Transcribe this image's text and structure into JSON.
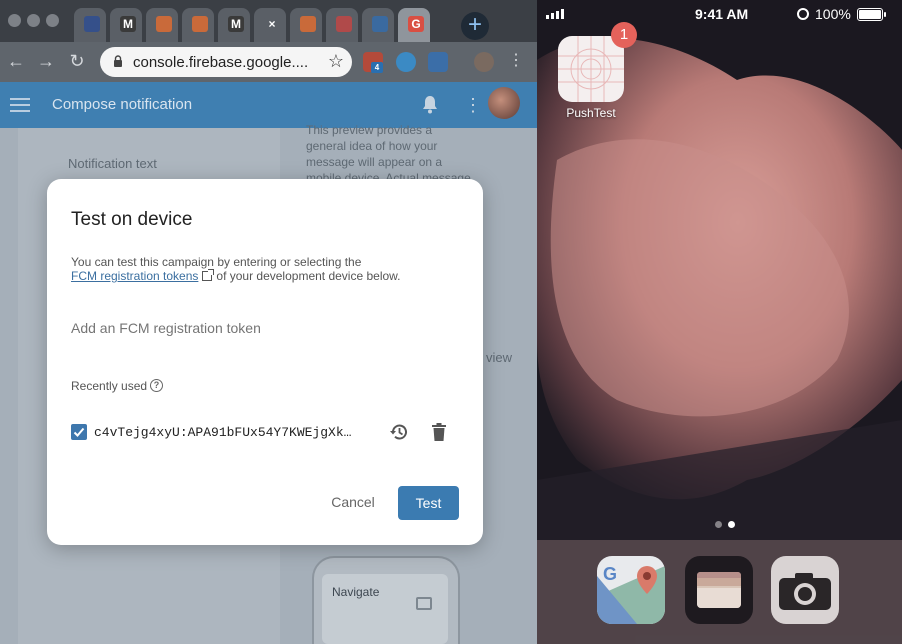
{
  "browser": {
    "url": "console.firebase.google....",
    "tabs": [
      {
        "fav": "",
        "color": "#35508a"
      },
      {
        "fav": "M",
        "color": "#3a3a3a"
      },
      {
        "fav": "",
        "color": "#c96a3a"
      },
      {
        "fav": "",
        "color": "#c96a3a"
      },
      {
        "fav": "M",
        "color": "#3a3a3a"
      },
      {
        "fav": "×",
        "color": "#5a5f66"
      },
      {
        "fav": "",
        "color": "#c96a3a"
      },
      {
        "fav": "",
        "color": "#b04a4a"
      },
      {
        "fav": "",
        "color": "#3a6aa0"
      },
      {
        "fav": "G",
        "color": "#d94f43"
      }
    ],
    "extensions": {
      "abp_count": "4"
    }
  },
  "appbar": {
    "title": "Compose notification"
  },
  "page": {
    "notification_text_label": "Notification text",
    "preview_text": "This preview provides a general idea of how your message will appear on a mobile device. Actual message",
    "preview_fragment": "view",
    "navigate_label": "Navigate"
  },
  "modal": {
    "title": "Test on device",
    "desc_line1": "You can test this campaign by entering or selecting the",
    "link_text": "FCM registration tokens",
    "desc_line2_suffix": "of your development device below.",
    "token_placeholder": "Add an FCM registration token",
    "recently_used_label": "Recently used",
    "token_value": "c4vTejg4xyU:APA91bFUx54Y7KWEjgXk…",
    "token_checked": true,
    "cancel_label": "Cancel",
    "test_label": "Test",
    "accent_color": "#3b7bb1"
  },
  "phone": {
    "time": "9:41 AM",
    "battery": "100%",
    "battery_level": 1.0,
    "app_label": "PushTest",
    "app_badge": "1"
  },
  "icons": [
    "hamburger-icon",
    "bell-icon",
    "more-vert-icon",
    "lock-icon",
    "star-icon",
    "history-icon",
    "delete-icon",
    "help-icon",
    "open-in-new-icon"
  ]
}
